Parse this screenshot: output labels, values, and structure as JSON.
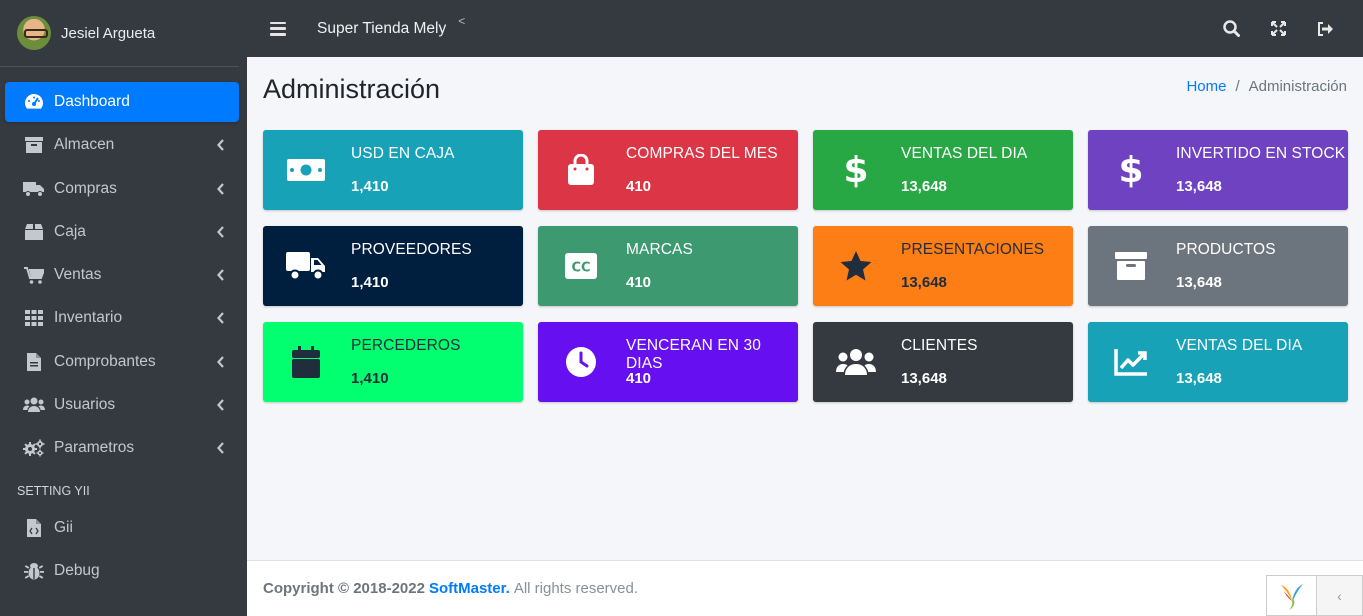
{
  "user": {
    "name": "Jesiel Argueta"
  },
  "sidebar": {
    "items": [
      {
        "label": "Dashboard",
        "icon": "tachometer-icon",
        "active": true
      },
      {
        "label": "Almacen",
        "icon": "archive-icon"
      },
      {
        "label": "Compras",
        "icon": "truck-icon"
      },
      {
        "label": "Caja",
        "icon": "box-icon"
      },
      {
        "label": "Ventas",
        "icon": "cart-icon"
      },
      {
        "label": "Inventario",
        "icon": "grid-icon"
      },
      {
        "label": "Comprobantes",
        "icon": "file-icon"
      },
      {
        "label": "Usuarios",
        "icon": "users-icon"
      },
      {
        "label": "Parametros",
        "icon": "cogs-icon"
      }
    ],
    "section_header": "SETTING YII",
    "setting_items": [
      {
        "label": "Gii",
        "icon": "file-code-icon"
      },
      {
        "label": "Debug",
        "icon": "bug-icon"
      }
    ]
  },
  "topbar": {
    "brand": "Super Tienda Mely",
    "caret": "<"
  },
  "header": {
    "title": "Administración",
    "breadcrumb": {
      "home": "Home",
      "separator": "/",
      "current": "Administración"
    }
  },
  "cards": [
    {
      "label": "USD EN CAJA",
      "value": "1,410",
      "color": "#17a2b8",
      "icon": "money-bill-icon"
    },
    {
      "label": "COMPRAS DEL MES",
      "value": "410",
      "color": "#dc3545",
      "icon": "shopping-bag-icon"
    },
    {
      "label": "VENTAS DEL DIA",
      "value": "13,648",
      "color": "#28a745",
      "icon": "dollar-icon"
    },
    {
      "label": "INVERTIDO EN STOCK",
      "value": "13,648",
      "color": "#6f42c1",
      "icon": "dollar-icon"
    },
    {
      "label": "PROVEEDORES",
      "value": "1,410",
      "color": "#001f3f",
      "icon": "truck-icon"
    },
    {
      "label": "MARCAS",
      "value": "410",
      "color": "#3d9970",
      "icon": "cc-icon"
    },
    {
      "label": "PRESENTACIONES",
      "value": "13,648",
      "color": "#fd7e14",
      "icon": "star-icon"
    },
    {
      "label": "PRODUCTOS",
      "value": "13,648",
      "color": "#6c757d",
      "icon": "archive-icon"
    },
    {
      "label": "PERCEDEROS",
      "value": "1,410",
      "color": "#01ff70",
      "icon": "calendar-icon"
    },
    {
      "label": "VENCERAN EN 30 DIAS",
      "value": "410",
      "color": "#6610f2",
      "icon": "clock-icon"
    },
    {
      "label": "CLIENTES",
      "value": "13,648",
      "color": "#343a40",
      "icon": "users-icon"
    },
    {
      "label": "VENTAS DEL DIA",
      "value": "13,648",
      "color": "#17a2b8",
      "icon": "chart-line-icon"
    }
  ],
  "footer": {
    "copyright": "Copyright © 2018-2022",
    "company": "SoftMaster.",
    "rights": "All rights reserved."
  },
  "debug_toolbar": {
    "toggle": "‹"
  }
}
